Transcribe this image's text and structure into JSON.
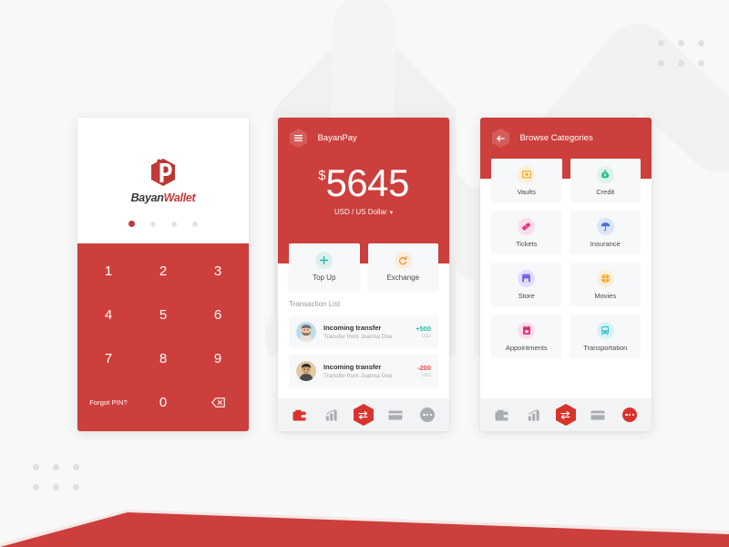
{
  "theme": {
    "brand_red": "#cc3f3c",
    "brand_red_dark": "#c43a38",
    "accent_teal": "#2bb7a8",
    "accent_orange": "#f0923a",
    "negative_red": "#e05252",
    "canvas": "#f8f8f8",
    "card": "#f7f8f9",
    "nav_bg": "#f2f3f4"
  },
  "screen1": {
    "name": "pin-entry-screen",
    "logo": {
      "icon": "hexagon-p-logo",
      "brand_part1": "Bayan",
      "brand_part2": "Wallet"
    },
    "carousel": {
      "total": 4,
      "active_index": 0
    },
    "keypad": {
      "keys": [
        "1",
        "2",
        "3",
        "4",
        "5",
        "6",
        "7",
        "8",
        "9"
      ],
      "forgot_label": "Forgot PIN?",
      "zero_label": "0",
      "backspace_icon": "backspace-icon"
    }
  },
  "screen2": {
    "name": "wallet-home-screen",
    "header": {
      "menu_icon": "hamburger-menu-icon",
      "title": "BayanPay"
    },
    "balance": {
      "currency_symbol": "$",
      "amount": "5645",
      "currency_label": "USD / US Dollar",
      "chevron_icon": "chevron-down-icon"
    },
    "actions": [
      {
        "label": "Top Up",
        "icon": "plus-circle-icon",
        "tone": "teal"
      },
      {
        "label": "Exchange",
        "icon": "refresh-circle-icon",
        "tone": "orange"
      }
    ],
    "transactions": {
      "section_title": "Transaction List",
      "items": [
        {
          "avatar": "avatar-male-bearded",
          "title": "Incoming transfer",
          "subtitle": "Transfer from Joanna Doe",
          "amount": "+500",
          "unit": "USD",
          "sign": "pos"
        },
        {
          "avatar": "avatar-male-dark-hair",
          "title": "Incoming transfer",
          "subtitle": "Transfer from Joanna Doe",
          "amount": "-200",
          "unit": "USD",
          "sign": "neg"
        }
      ]
    },
    "nav": [
      {
        "icon": "wallet-icon",
        "active": true
      },
      {
        "icon": "bar-chart-icon",
        "active": false
      },
      {
        "icon": "transfer-hexagon-icon",
        "active": true
      },
      {
        "icon": "credit-card-icon",
        "active": false
      },
      {
        "icon": "more-dots-icon",
        "active": false
      }
    ]
  },
  "screen3": {
    "name": "browse-categories-screen",
    "header": {
      "back_icon": "arrow-left-icon",
      "title": "Browse Categories"
    },
    "categories": [
      {
        "label": "Vaults",
        "icon": "safe-icon",
        "fg": "#f5a623",
        "bg": "#fdeedb"
      },
      {
        "label": "Credit",
        "icon": "money-bag-icon",
        "fg": "#2fbf8f",
        "bg": "#ddf4e9"
      },
      {
        "label": "Tickets",
        "icon": "ticket-icon",
        "fg": "#e8337f",
        "bg": "#fcdfeb"
      },
      {
        "label": "Insurance",
        "icon": "umbrella-icon",
        "fg": "#4a6ee0",
        "bg": "#dde4f8"
      },
      {
        "label": "Store",
        "icon": "storefront-icon",
        "fg": "#6b5ce7",
        "bg": "#e1ddfa"
      },
      {
        "label": "Movies",
        "icon": "film-reel-icon",
        "fg": "#f5a623",
        "bg": "#fdeedb"
      },
      {
        "label": "Appointments",
        "icon": "calendar-icon",
        "fg": "#e8337f",
        "bg": "#fcdfeb"
      },
      {
        "label": "Transportation",
        "icon": "bus-icon",
        "fg": "#34c3d4",
        "bg": "#d8f3f7"
      }
    ],
    "nav": [
      {
        "icon": "wallet-icon",
        "active": false
      },
      {
        "icon": "bar-chart-icon",
        "active": false
      },
      {
        "icon": "transfer-hexagon-icon",
        "active": true
      },
      {
        "icon": "credit-card-icon",
        "active": false
      },
      {
        "icon": "more-dots-icon",
        "active": true
      }
    ]
  },
  "decor": {
    "dot_grid_top_right": "decorative-dot-grid",
    "dot_grid_bottom_left": "decorative-dot-grid",
    "zigzag": "decorative-trend-chevron",
    "red_wedge": "decorative-red-wedge"
  }
}
